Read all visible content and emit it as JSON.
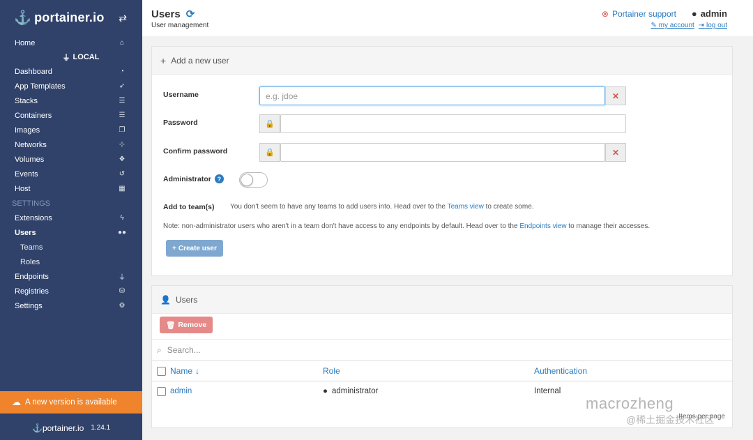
{
  "sidebar": {
    "brand": "portainer.io",
    "home": "Home",
    "endpoint": "LOCAL",
    "items": [
      {
        "label": "Dashboard",
        "icon": "dashboard-icon",
        "glyph": "◔"
      },
      {
        "label": "App Templates",
        "icon": "rocket-icon",
        "glyph": "➶"
      },
      {
        "label": "Stacks",
        "icon": "stacks-icon",
        "glyph": "☰"
      },
      {
        "label": "Containers",
        "icon": "containers-icon",
        "glyph": "☰"
      },
      {
        "label": "Images",
        "icon": "images-icon",
        "glyph": "❐"
      },
      {
        "label": "Networks",
        "icon": "sitemap-icon",
        "glyph": "⊹"
      },
      {
        "label": "Volumes",
        "icon": "cubes-icon",
        "glyph": "❖"
      },
      {
        "label": "Events",
        "icon": "history-icon",
        "glyph": "↺"
      },
      {
        "label": "Host",
        "icon": "th-icon",
        "glyph": "▦"
      }
    ],
    "settings_title": "SETTINGS",
    "settings_items": [
      {
        "label": "Extensions",
        "icon": "bolt-icon",
        "glyph": "ϟ"
      },
      {
        "label": "Users",
        "icon": "users-icon",
        "glyph": "👥"
      }
    ],
    "users_sub": [
      "Teams",
      "Roles"
    ],
    "bottom_items": [
      {
        "label": "Endpoints",
        "icon": "plug-icon",
        "glyph": "⏚"
      },
      {
        "label": "Registries",
        "icon": "database-icon",
        "glyph": "⛁"
      },
      {
        "label": "Settings",
        "icon": "cogs-icon",
        "glyph": "⚙"
      }
    ],
    "update_text": "A new version is available",
    "footer_brand": "portainer.io",
    "version": "1.24.1"
  },
  "header": {
    "title": "Users",
    "subtitle": "User management",
    "support": "Portainer support",
    "user": "admin",
    "my_account": "my account",
    "log_out": "log out"
  },
  "form": {
    "panel_title": "Add a new user",
    "username_label": "Username",
    "username_placeholder": "e.g. jdoe",
    "password_label": "Password",
    "confirm_label": "Confirm password",
    "admin_label": "Administrator",
    "teams_label": "Add to team(s)",
    "teams_note_pre": "You don't seem to have any teams to add users into. Head over to the",
    "teams_link": "Teams view",
    "teams_note_post": "to create some.",
    "access_note_pre": "Note: non-administrator users who aren't in a team don't have access to any endpoints by default. Head over to the",
    "access_link": "Endpoints view",
    "access_note_post": "to manage their accesses.",
    "create_button": "Create user"
  },
  "users_table": {
    "panel_title": "Users",
    "remove_button": "Remove",
    "search_placeholder": "Search...",
    "columns": [
      "Name",
      "Role",
      "Authentication"
    ],
    "rows": [
      {
        "name": "admin",
        "role": "administrator",
        "auth": "Internal"
      }
    ],
    "pager": "Items per page"
  },
  "watermark": {
    "line1": "macrozheng",
    "line2": "@稀土掘金技术社区"
  },
  "colors": {
    "sidebar": "#30426a",
    "accent": "#2a7bbf",
    "update_bar": "#f0842c",
    "danger": "#d9534f"
  }
}
